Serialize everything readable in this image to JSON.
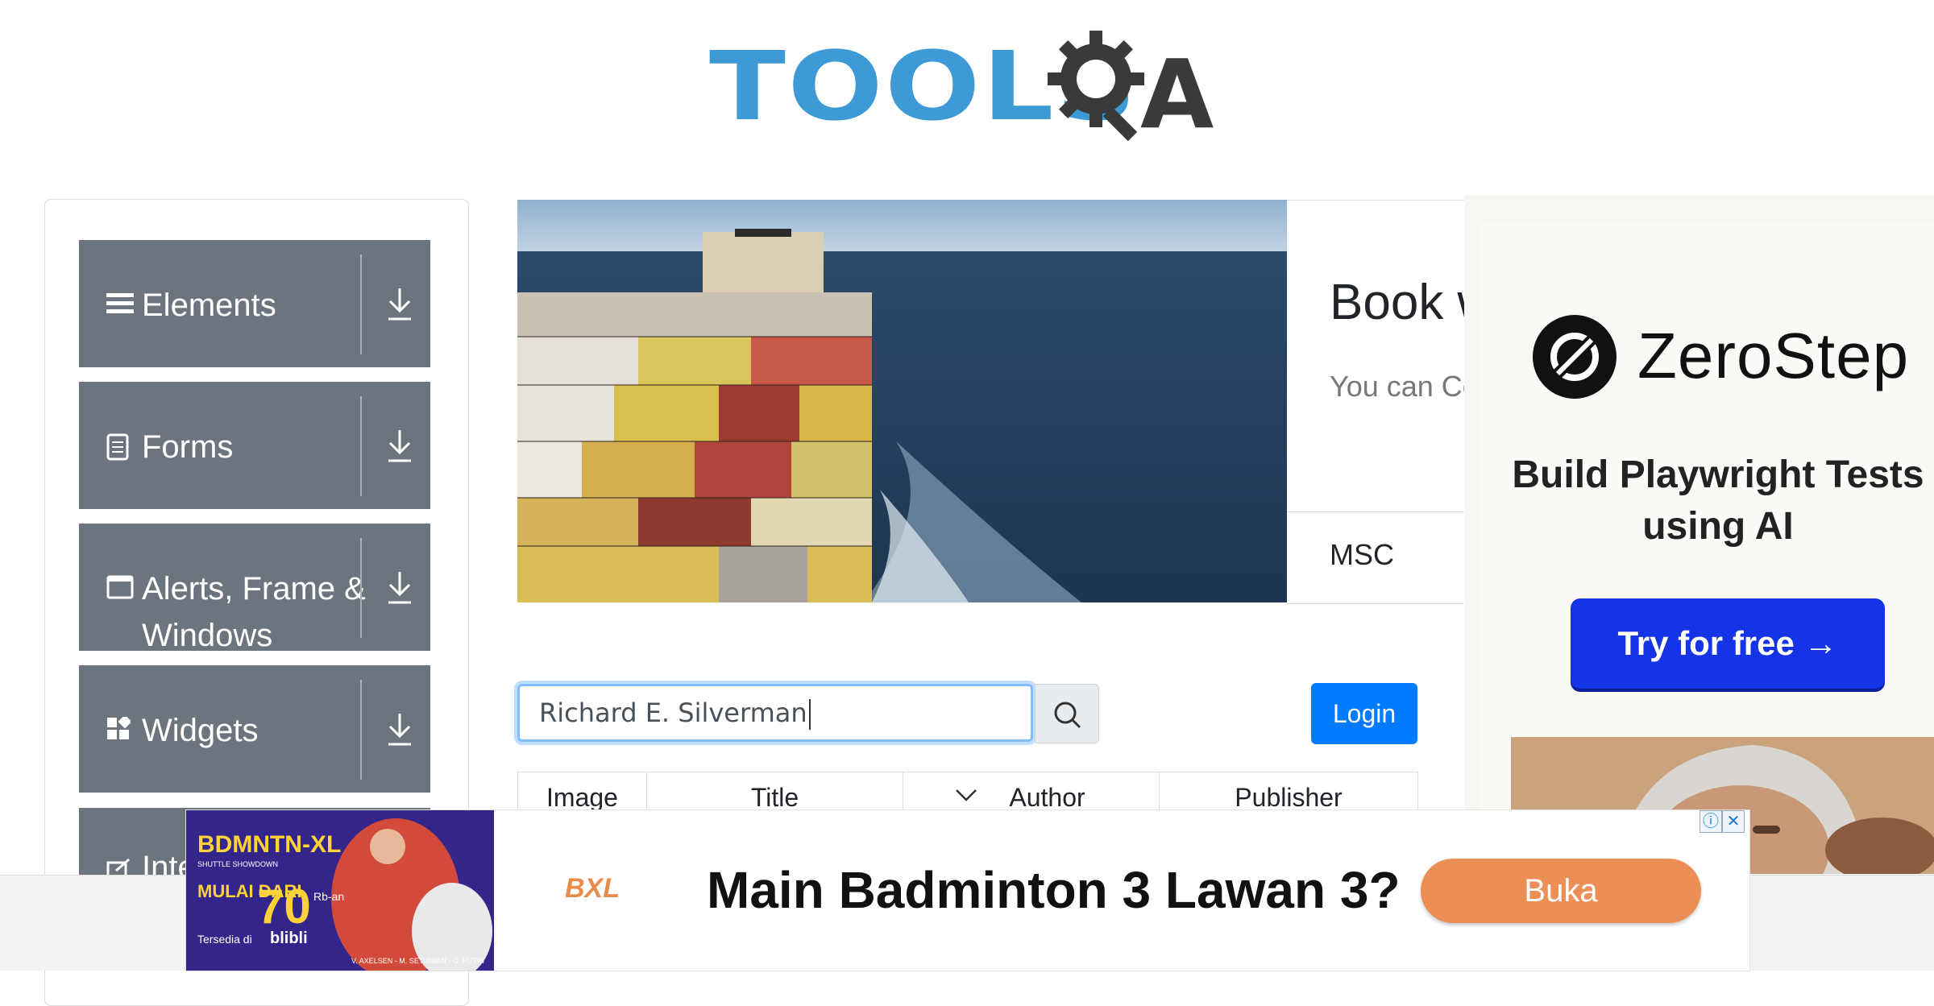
{
  "logo": {
    "text": "TOOLS",
    "suffix": "A",
    "colors": {
      "primary": "#3d9ad6",
      "dark": "#3a3a3a"
    }
  },
  "sidebar": {
    "items": [
      {
        "label": "Elements",
        "icon": "hamburger-icon"
      },
      {
        "label": "Forms",
        "icon": "document-icon"
      },
      {
        "label": "Alerts, Frame & Windows",
        "icon": "window-icon"
      },
      {
        "label": "Widgets",
        "icon": "widgets-icon"
      },
      {
        "label": "Inte",
        "icon": "interactions-icon"
      }
    ]
  },
  "banner": {
    "title": "Book w",
    "description": "You can Co Book Again",
    "footer": "MSC"
  },
  "search": {
    "value": "Richard E. Silverman",
    "icon": "search-icon"
  },
  "login": {
    "label": "Login",
    "color": "#007bff"
  },
  "table": {
    "headers": [
      "Image",
      "Title",
      "Author",
      "Publisher"
    ],
    "sort_icon": "chevron-down-icon"
  },
  "right_ad": {
    "brand": "ZeroStep",
    "tagline": "Build Playwright Tests using AI",
    "cta": "Try for free →",
    "cta_color": "#1434e6"
  },
  "bottom_ad": {
    "image_text": {
      "title": "BDMNTN-XL",
      "subtitle": "SHUTTLE SHOWDOWN",
      "promo": "MULAI DARI",
      "price": "70",
      "unit": "Rb-an",
      "available": "Tersedia di",
      "store": "blibli",
      "players": "V. AXELSEN - M. SETIAWAN - G. PUTRI"
    },
    "brand": "BXL",
    "headline": "Main Badminton 3 Lawan 3?",
    "cta": "Buka",
    "cta_color": "#ec8f57",
    "info_icon": "info-icon",
    "close_icon": "close-icon"
  }
}
